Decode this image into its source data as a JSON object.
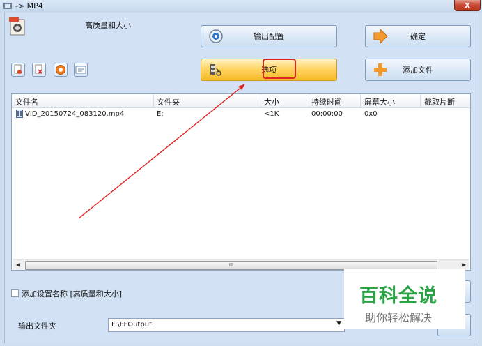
{
  "window": {
    "title": "-> MP4",
    "close_label": "x"
  },
  "profile": {
    "label": "高质量和大小"
  },
  "buttons": {
    "output_config": "输出配置",
    "ok": "确定",
    "options": "选项",
    "add_file": "添加文件"
  },
  "table": {
    "columns": [
      "文件名",
      "文件夹",
      "大小",
      "持续时间",
      "屏幕大小",
      "截取片断"
    ],
    "rows": [
      {
        "name": "VID_20150724_083120.mp4",
        "folder": "E:",
        "size": "<1K",
        "duration": "00:00:00",
        "screen": "0x0",
        "clip": ""
      }
    ],
    "scroll_thumb": "III"
  },
  "settings": {
    "add_setting_name_label": "添加设置名称 [高质量和大小]",
    "output_folder_label": "输出文件夹",
    "output_folder_value": "F:\\FFOutput"
  },
  "watermark": {
    "title": "百科全说",
    "subtitle": "助你轻松解决"
  },
  "colors": {
    "highlight": "#e02424",
    "watermark_green": "#2aa345"
  }
}
